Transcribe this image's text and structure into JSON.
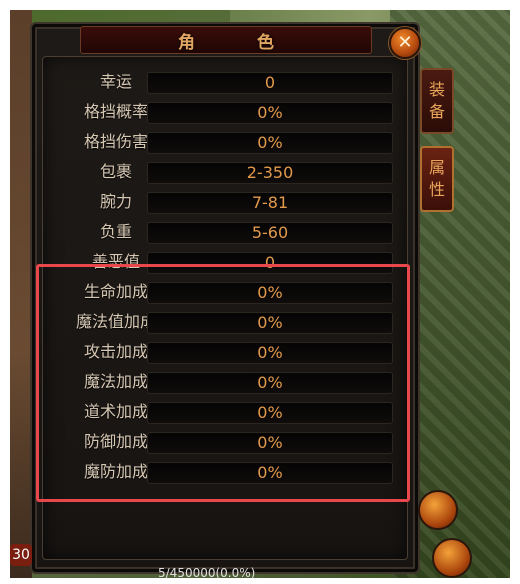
{
  "window": {
    "title": "角 色",
    "close_label": "✕",
    "colors": {
      "value_text": "#e39a4c",
      "label_text": "#d6c7b3",
      "title_text": "#e0a560",
      "highlight": "#e8474c"
    }
  },
  "side_tabs": [
    {
      "label_top": "装",
      "label_bottom": "备"
    },
    {
      "label_top": "属",
      "label_bottom": "性"
    }
  ],
  "stats": [
    {
      "label": "幸运",
      "value": "0"
    },
    {
      "label": "格挡概率",
      "value": "0%"
    },
    {
      "label": "格挡伤害",
      "value": "0%"
    },
    {
      "label": "包裹",
      "value": "2-350"
    },
    {
      "label": "腕力",
      "value": "7-81"
    },
    {
      "label": "负重",
      "value": "5-60"
    },
    {
      "label": "善恶值",
      "value": "0"
    },
    {
      "label": "生命加成",
      "value": "0%"
    },
    {
      "label": "魔法值加成",
      "value": "0%"
    },
    {
      "label": "攻击加成",
      "value": "0%"
    },
    {
      "label": "魔法加成",
      "value": "0%"
    },
    {
      "label": "道术加成",
      "value": "0%"
    },
    {
      "label": "防御加成",
      "value": "0%"
    },
    {
      "label": "魔防加成",
      "value": "0%"
    }
  ],
  "hud": {
    "level_badge": "30",
    "exp_text": "5/450000(0.0%)"
  }
}
